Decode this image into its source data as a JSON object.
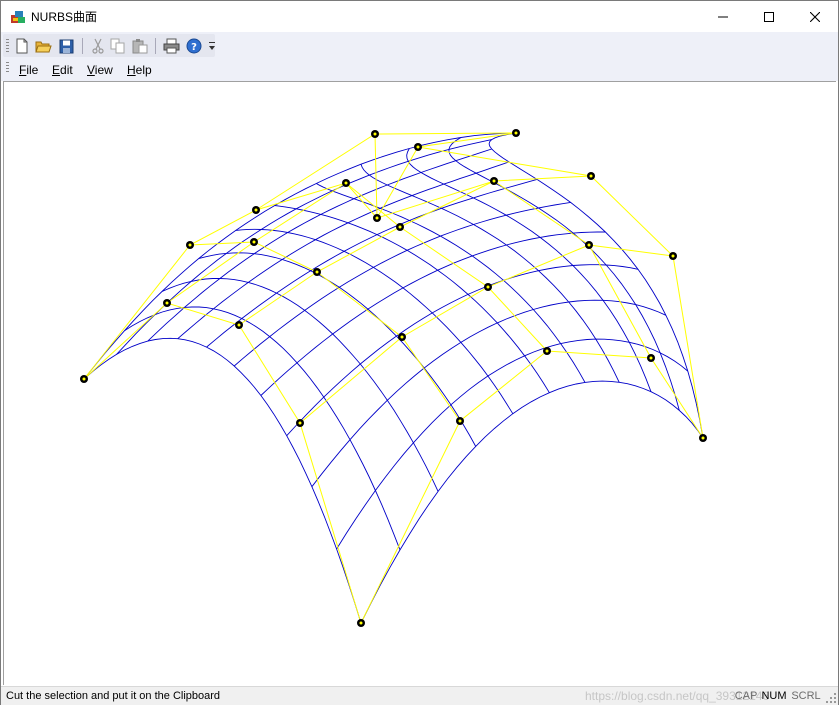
{
  "window": {
    "title": "NURBS曲面",
    "controls": {
      "minimize": "minimize-icon",
      "maximize": "maximize-icon",
      "close": "close-icon"
    }
  },
  "toolbar": {
    "buttons": [
      {
        "name": "new-file-icon"
      },
      {
        "name": "open-folder-icon"
      },
      {
        "name": "save-icon"
      },
      {
        "name": "cut-icon"
      },
      {
        "name": "copy-icon"
      },
      {
        "name": "paste-icon"
      },
      {
        "name": "print-icon"
      },
      {
        "name": "help-icon"
      }
    ]
  },
  "menu": {
    "items": [
      {
        "label_accel": "F",
        "label_rest": "ile"
      },
      {
        "label_accel": "E",
        "label_rest": "dit"
      },
      {
        "label_accel": "V",
        "label_rest": "iew"
      },
      {
        "label_accel": "H",
        "label_rest": "elp"
      }
    ]
  },
  "status": {
    "message": "Cut the selection and put it on the Clipboard",
    "watermark": "https://blog.csdn.net/qq_39312146",
    "indicators": [
      {
        "label": "CAP",
        "active": false
      },
      {
        "label": "NUM",
        "active": true
      },
      {
        "label": "SCRL",
        "active": false
      }
    ]
  },
  "colors": {
    "surface_mesh": "#0000c8",
    "control_net": "#ffff00",
    "control_point": "#000000",
    "background": "#ffffff"
  }
}
